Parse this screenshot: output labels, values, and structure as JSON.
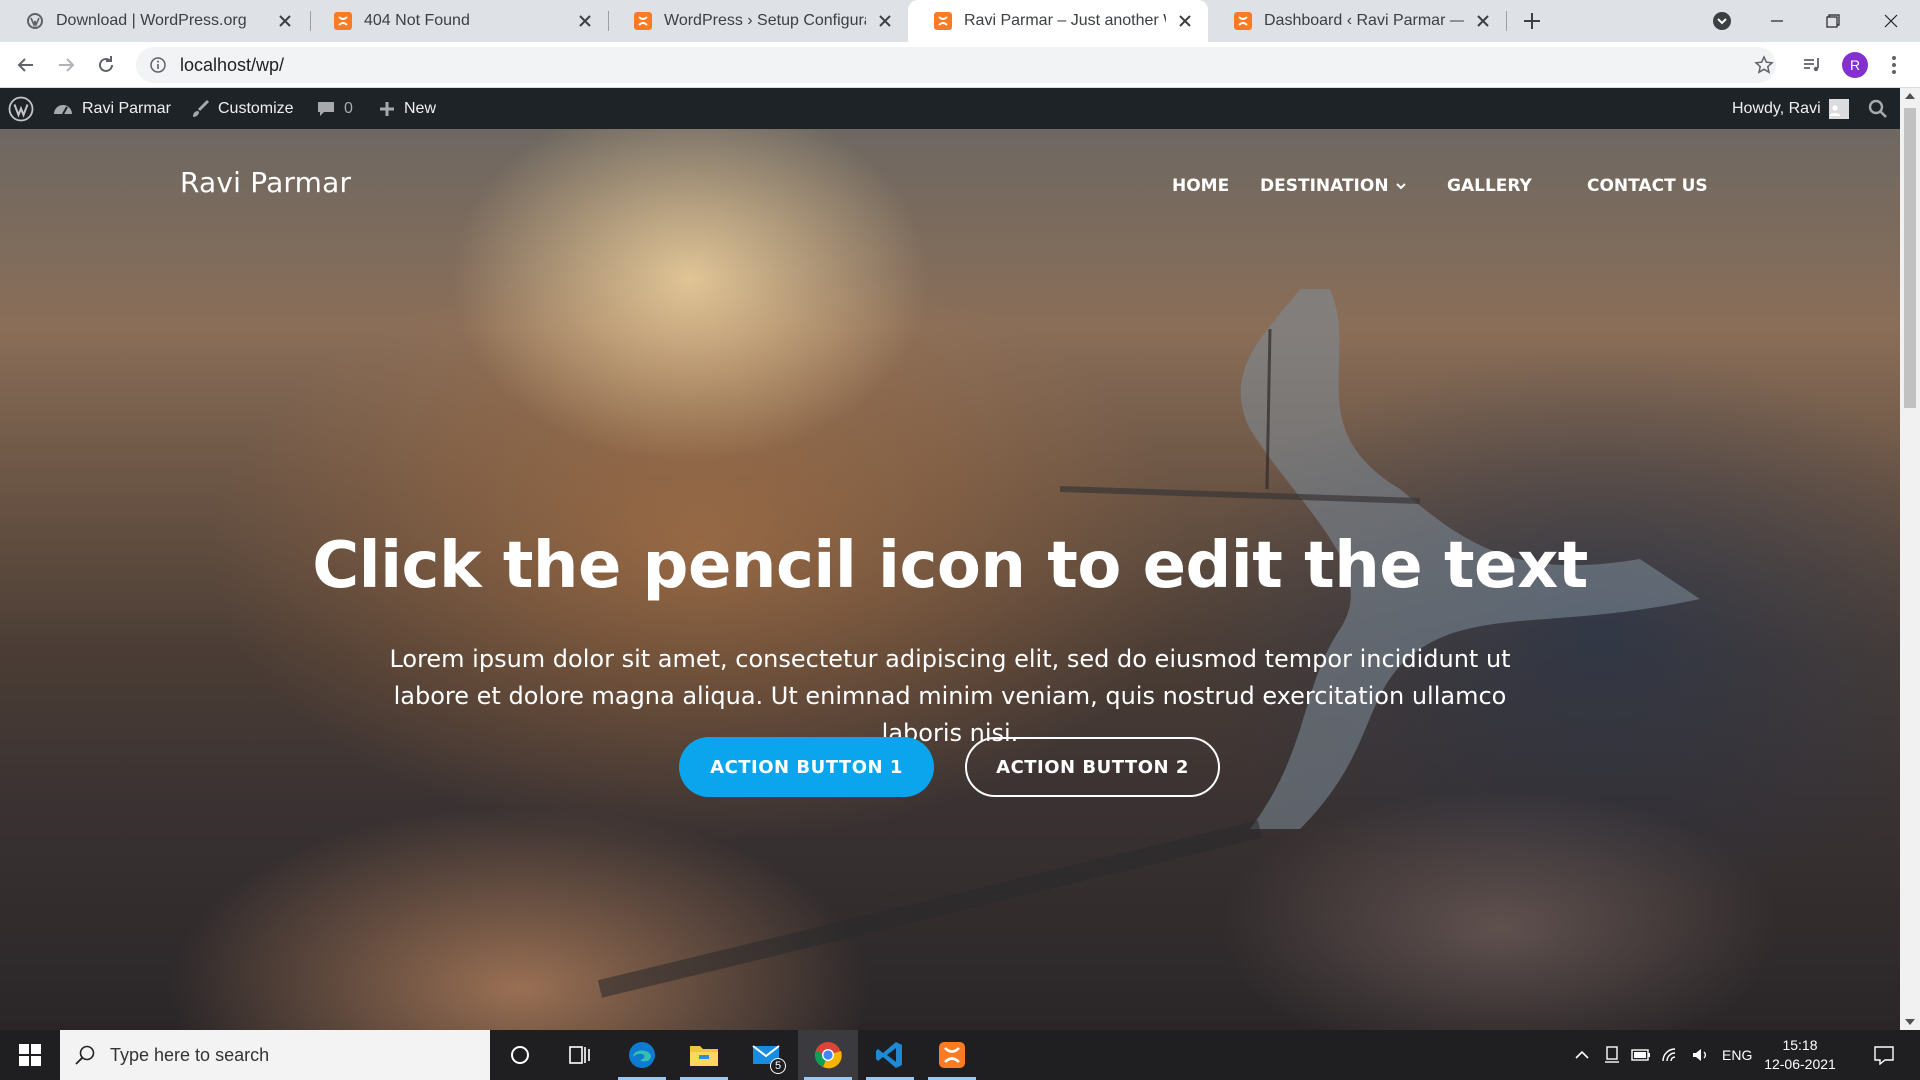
{
  "browser": {
    "tabs": [
      {
        "title": "Download | WordPress.org",
        "favicon": "wordpress-icon"
      },
      {
        "title": "404 Not Found",
        "favicon": "xampp-icon"
      },
      {
        "title": "WordPress › Setup Configuration",
        "favicon": "xampp-icon"
      },
      {
        "title": "Ravi Parmar – Just another WordPress site",
        "favicon": "xampp-icon",
        "active": true
      },
      {
        "title": "Dashboard ‹ Ravi Parmar — WordPress",
        "favicon": "xampp-icon"
      }
    ],
    "url": "localhost/wp/",
    "profile_initial": "R",
    "profile_color": "#8430ce"
  },
  "admin_bar": {
    "site_name": "Ravi Parmar",
    "customize": "Customize",
    "comments_count": "0",
    "new_label": "New",
    "howdy": "Howdy, Ravi",
    "background": "#1d2327"
  },
  "site": {
    "title": "Ravi Parmar",
    "menu": [
      "HOME",
      "DESTINATION",
      "GALLERY",
      "CONTACT US"
    ],
    "hero_title": "Click the pencil icon to edit the text",
    "hero_text": "Lorem ipsum dolor sit amet, consectetur adipiscing elit, sed do eiusmod tempor incididunt ut labore et dolore magna aliqua. Ut enimnad minim veniam, quis nostrud exercitation ullamco laboris nisi.",
    "button1": "ACTION BUTTON 1",
    "button2": "ACTION BUTTON 2",
    "accent": "#0aa5ec"
  },
  "taskbar": {
    "search_placeholder": "Type here to search",
    "mail_badge": "5",
    "language": "ENG",
    "time": "15:18",
    "date": "12-06-2021"
  }
}
